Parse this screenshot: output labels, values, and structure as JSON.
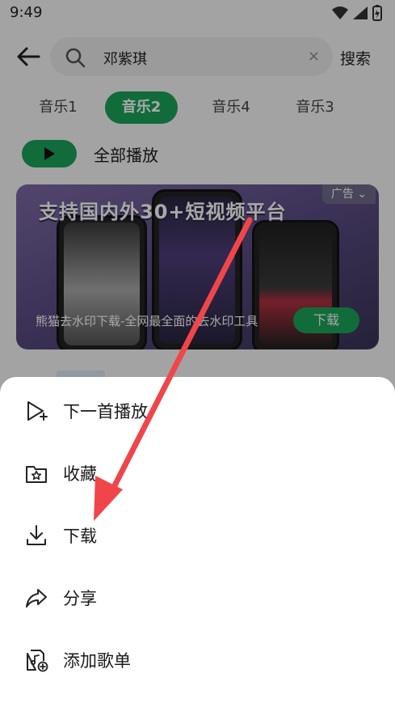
{
  "status_bar": {
    "time": "9:49"
  },
  "search": {
    "query": "邓紫琪",
    "clear_glyph": "×",
    "button_label": "搜索"
  },
  "tabs": [
    {
      "label": "音乐1",
      "active": false
    },
    {
      "label": "音乐2",
      "active": true
    },
    {
      "label": "音乐4",
      "active": false
    },
    {
      "label": "音乐3",
      "active": false
    }
  ],
  "play_all": {
    "label": "全部播放"
  },
  "ad": {
    "headline": "支持国内外30+短视频平台",
    "tag": "广告",
    "caption": "熊猫去水印下载-全网最全面的去水印工具",
    "download_label": "下载"
  },
  "menu": {
    "items": [
      {
        "label": "下一首播放",
        "icon": "play-next-icon"
      },
      {
        "label": "收藏",
        "icon": "favorite-folder-icon"
      },
      {
        "label": "下载",
        "icon": "download-icon"
      },
      {
        "label": "分享",
        "icon": "share-icon"
      },
      {
        "label": "添加歌单",
        "icon": "add-to-playlist-icon"
      }
    ]
  },
  "colors": {
    "accent": "#1aa35a",
    "annotation_arrow": "#f0464a",
    "scrim": "rgba(0,0,0,0.34)"
  }
}
